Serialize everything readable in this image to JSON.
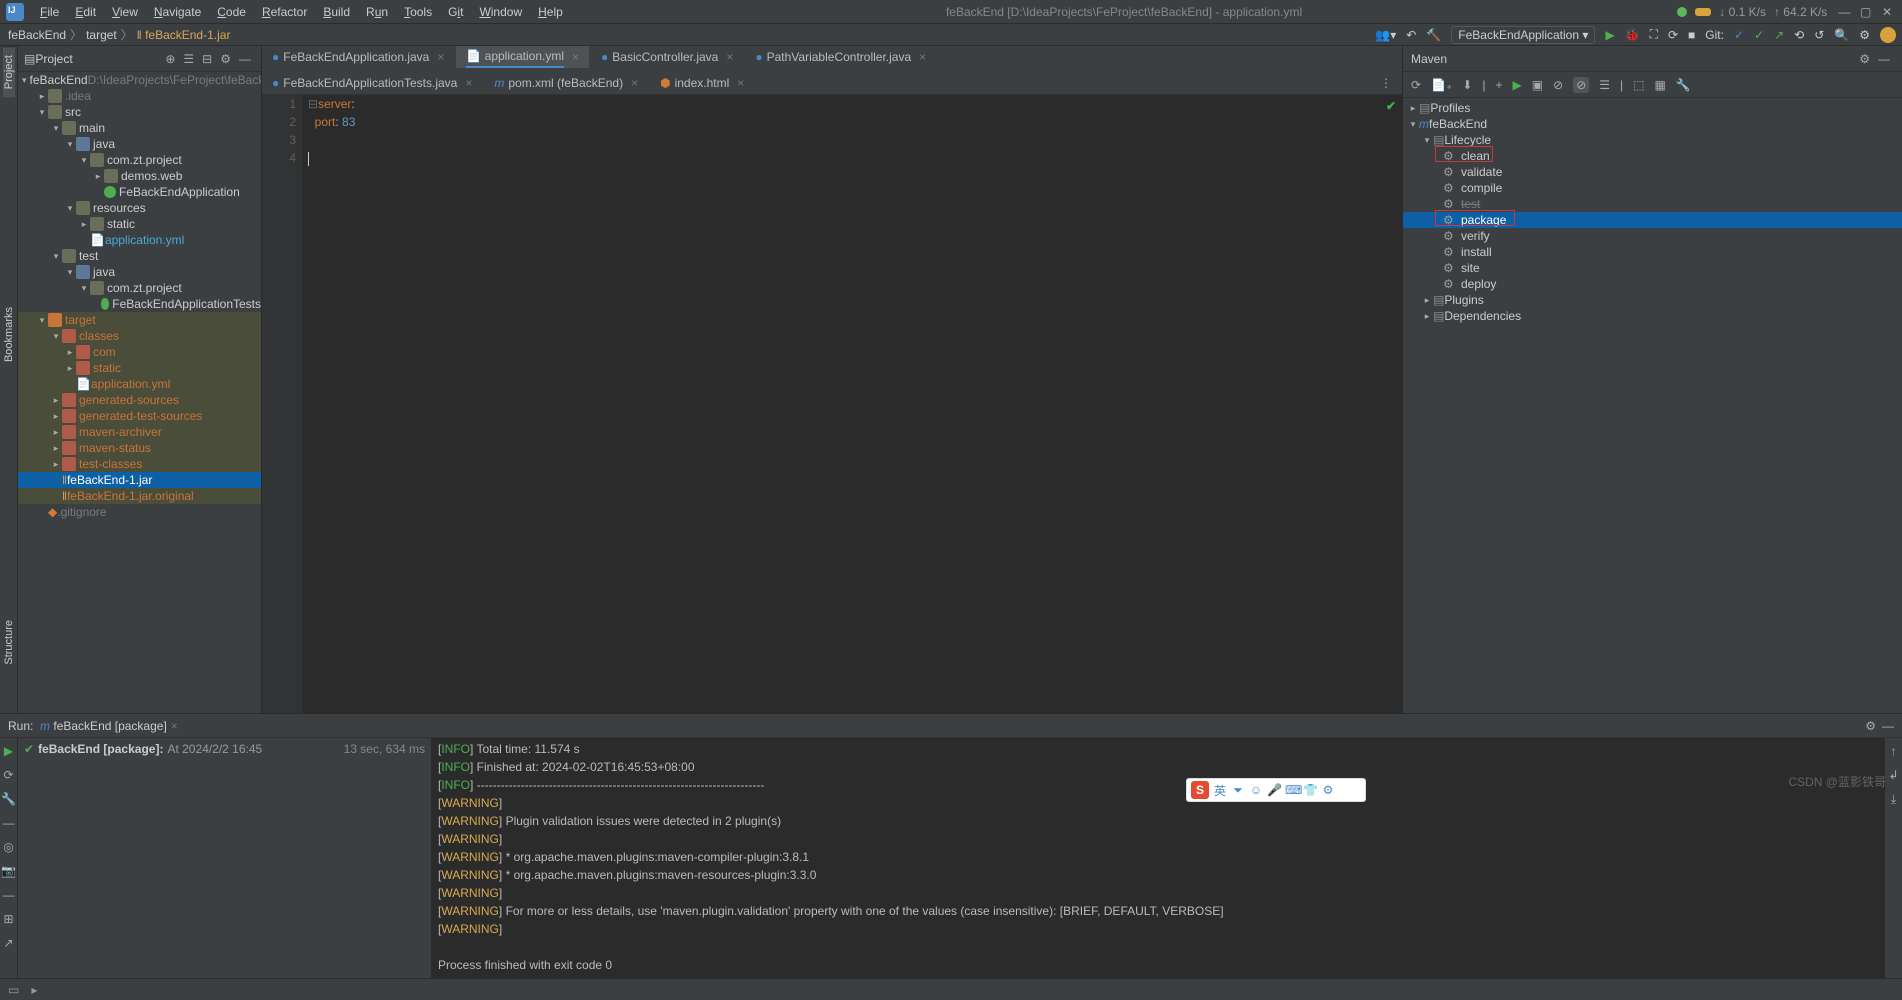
{
  "menu": {
    "items": [
      "File",
      "Edit",
      "View",
      "Navigate",
      "Code",
      "Refactor",
      "Build",
      "Run",
      "Tools",
      "Git",
      "Window",
      "Help"
    ]
  },
  "window_title": "feBackEnd [D:\\IdeaProjects\\FeProject\\feBackEnd] - application.yml",
  "netstats": {
    "down": "↓ 0.1 K/s",
    "up": "↑ 64.2 K/s"
  },
  "breadcrumb": {
    "root": "feBackEnd",
    "target": "target",
    "jar": "feBackEnd-1.jar"
  },
  "runconfig": "FeBackEndApplication ▾",
  "git_label": "Git:",
  "project_panel": {
    "title": "Project"
  },
  "tree": {
    "proj": "feBackEnd",
    "proj_path": " D:\\IdeaProjects\\FeProject\\feBack...",
    "idea": ".idea",
    "src": "src",
    "main": "main",
    "java": "java",
    "com": "com.zt.project",
    "demos": "demos.web",
    "app": "FeBackEndApplication",
    "resources": "resources",
    "static": "static",
    "yml": "application.yml",
    "test": "test",
    "java2": "java",
    "com2": "com.zt.project",
    "apptests": "FeBackEndApplicationTests",
    "target": "target",
    "classes": "classes",
    "comf": "com",
    "staticf": "static",
    "ymlf": "application.yml",
    "gensrc": "generated-sources",
    "gentest": "generated-test-sources",
    "archiver": "maven-archiver",
    "mstatus": "maven-status",
    "testcls": "test-classes",
    "jar1": "feBackEnd-1.jar",
    "jar2": "feBackEnd-1.jar.original",
    "gitignore": ".gitignore"
  },
  "tabs": {
    "1": "FeBackEndApplication.java",
    "2": "application.yml",
    "3": "BasicController.java",
    "4": "PathVariableController.java",
    "5": "FeBackEndApplicationTests.java",
    "6": "pom.xml (feBackEnd)",
    "7": "index.html"
  },
  "code": {
    "line1": "server",
    "line2a": "port",
    "line2b": "83"
  },
  "maven": {
    "title": "Maven",
    "profiles": "Profiles",
    "proj": "feBackEnd",
    "lifecycle": "Lifecycle",
    "clean": "clean",
    "validate": "validate",
    "compile": "compile",
    "test": "test",
    "package": "package",
    "verify": "verify",
    "install": "install",
    "site": "site",
    "deploy": "deploy",
    "plugins": "Plugins",
    "deps": "Dependencies"
  },
  "run": {
    "label": "Run:",
    "tab": "feBackEnd [package]",
    "statusline": "feBackEnd [package]:",
    "statuswhen": " At 2024/2/2 16:45",
    "timing": "13 sec, 634 ms",
    "console": [
      {
        "lvl": "INFO",
        "txt": " Total time:   11.574 s"
      },
      {
        "lvl": "INFO",
        "txt": " Finished at: 2024-02-02T16:45:53+08:00"
      },
      {
        "lvl": "INFO",
        "txt": " ------------------------------------------------------------------------"
      },
      {
        "lvl": "WARNING",
        "txt": " "
      },
      {
        "lvl": "WARNING",
        "txt": " Plugin validation issues were detected in 2 plugin(s)"
      },
      {
        "lvl": "WARNING",
        "txt": " "
      },
      {
        "lvl": "WARNING",
        "txt": "  * org.apache.maven.plugins:maven-compiler-plugin:3.8.1"
      },
      {
        "lvl": "WARNING",
        "txt": "  * org.apache.maven.plugins:maven-resources-plugin:3.3.0"
      },
      {
        "lvl": "WARNING",
        "txt": " "
      },
      {
        "lvl": "WARNING",
        "txt": " For more or less details, use 'maven.plugin.validation' property with one of the values (case insensitive): [BRIEF, DEFAULT, VERBOSE]"
      },
      {
        "lvl": "WARNING",
        "txt": " "
      }
    ],
    "exit": "Process finished with exit code 0"
  },
  "sidebars": {
    "project": "Project",
    "bookmarks": "Bookmarks",
    "structure": "Structure"
  },
  "watermark": "CSDN @蓝影铁哥"
}
